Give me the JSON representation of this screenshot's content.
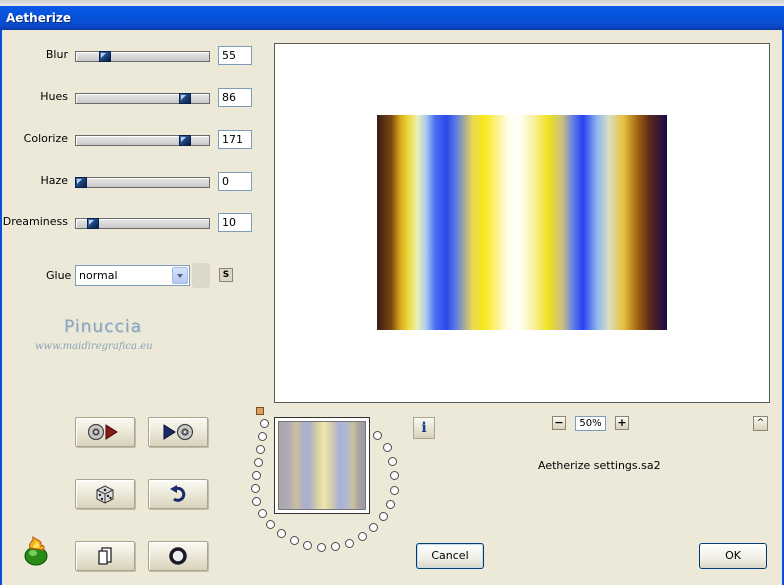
{
  "window": {
    "title": "Aetherize"
  },
  "sliders": [
    {
      "label": "Blur",
      "value": "55",
      "fraction": 0.22
    },
    {
      "label": "Hues",
      "value": "86",
      "fraction": 0.82
    },
    {
      "label": "Colorize",
      "value": "171",
      "fraction": 0.82
    },
    {
      "label": "Haze",
      "value": "0",
      "fraction": 0.04
    },
    {
      "label": "Dreaminess",
      "value": "10",
      "fraction": 0.13
    }
  ],
  "glue": {
    "label": "Glue",
    "value": "normal",
    "s_label": "S"
  },
  "watermark": {
    "name": "Pinuccia",
    "url": "www.maidiregrafica.eu"
  },
  "preview": {
    "zoom": "50%",
    "zoom_minus": "−",
    "zoom_plus": "+",
    "collapse": "^"
  },
  "info_label": "i",
  "settings_file": "Aetherize settings.sa2",
  "buttons": {
    "cancel": "Cancel",
    "ok": "OK"
  },
  "icons": {
    "load_preset": "disc-arrow-icon",
    "save_preset": "arrow-disc-icon",
    "randomize": "dice-icon",
    "reset": "undo-icon",
    "copy": "copy-icon",
    "help": "circle-icon",
    "app_logo": "flame-logo-icon"
  }
}
